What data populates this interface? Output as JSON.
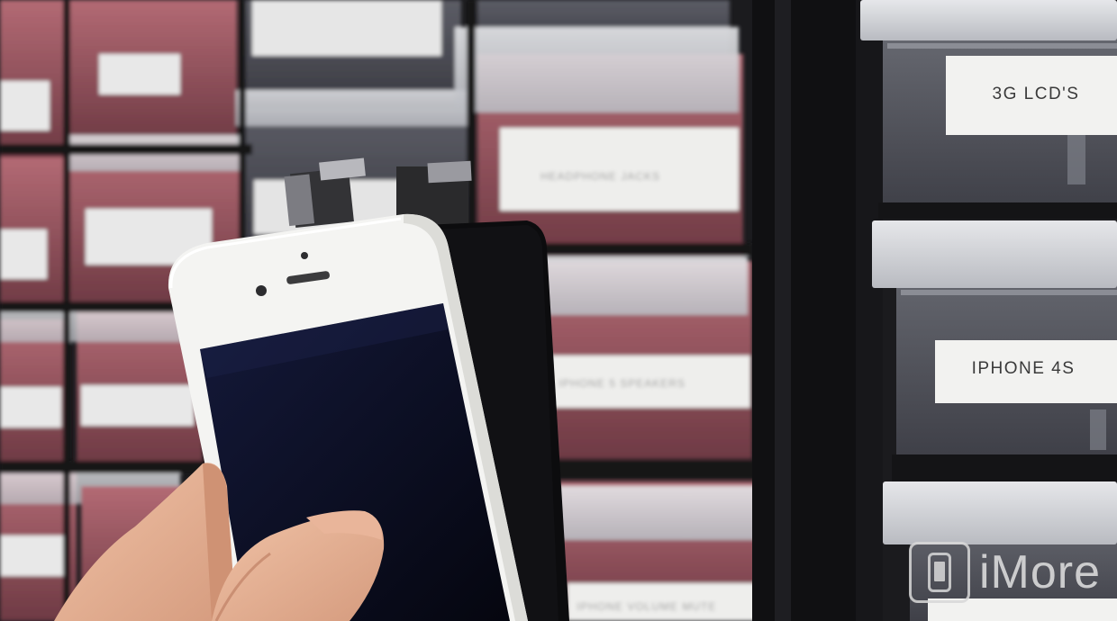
{
  "scene": {
    "labels": {
      "lcd_3g": "3G LCD'S",
      "iphone_4s": "IPHONE 4S"
    },
    "blurred_labels": {
      "headphone": "HEADPHONE JACKS",
      "speakers": "IPHONE 5 SPEAKERS",
      "volume": "IPHONE VOLUME MUTE"
    },
    "watermark": {
      "text": "iMore",
      "icon": "phone-in-rounded-square-icon"
    }
  },
  "colors": {
    "drawer_red": "#9a4f5a",
    "frame_black": "#121214",
    "label_white": "#f2f2f0",
    "phone_white": "#f4f4f2",
    "screen_dark": "#0c0f24"
  }
}
